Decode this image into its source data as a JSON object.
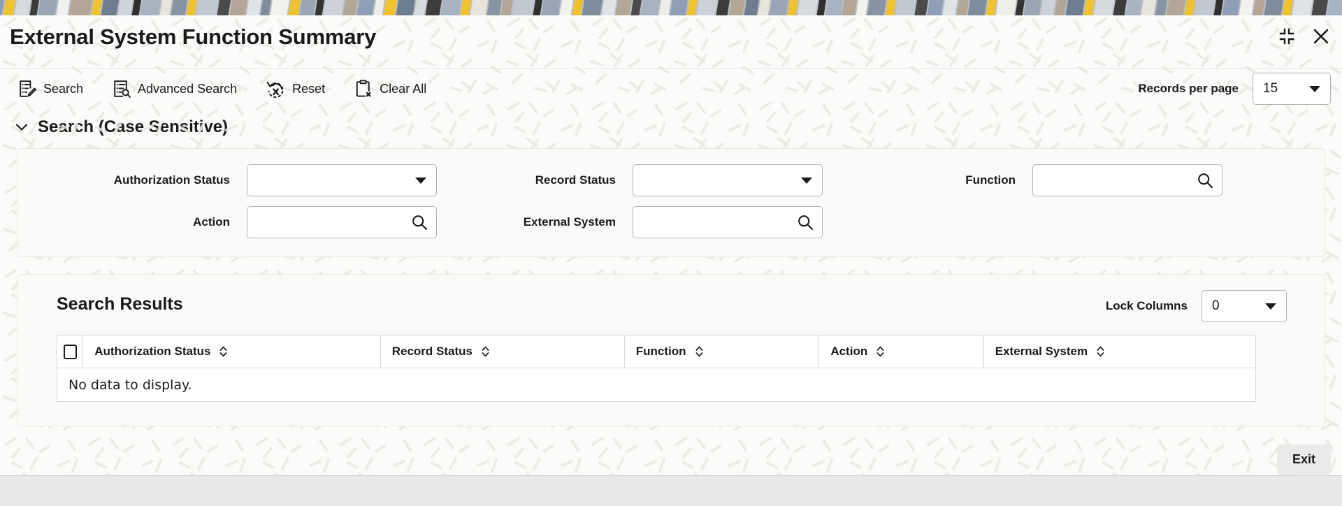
{
  "window": {
    "title": "External System Function Summary",
    "controls": [
      {
        "name": "minimize-restore-icon",
        "label": "Minimize"
      },
      {
        "name": "close-icon",
        "label": "Close"
      }
    ]
  },
  "toolbar": {
    "items": [
      {
        "icon": "search-form-icon",
        "label": "Search"
      },
      {
        "icon": "advanced-search-icon",
        "label": "Advanced Search"
      },
      {
        "icon": "reset-icon",
        "label": "Reset"
      },
      {
        "icon": "clear-all-icon",
        "label": "Clear All"
      }
    ],
    "records_per_page_label": "Records per page",
    "records_per_page_value": "15"
  },
  "search_section": {
    "title": "Search (Case Sensitive)",
    "expanded": true,
    "fields": [
      {
        "label": "Authorization Status",
        "type": "select",
        "value": "",
        "placeholder": ""
      },
      {
        "label": "Record Status",
        "type": "select",
        "value": "",
        "placeholder": ""
      },
      {
        "label": "Function",
        "type": "lov",
        "value": "",
        "placeholder": ""
      },
      {
        "label": "Action",
        "type": "lov",
        "value": "",
        "placeholder": ""
      },
      {
        "label": "External System",
        "type": "lov",
        "value": "",
        "placeholder": ""
      }
    ]
  },
  "results": {
    "title": "Search Results",
    "lock_columns_label": "Lock Columns",
    "lock_columns_value": "0",
    "columns": [
      {
        "label": "Authorization Status",
        "sortable": true
      },
      {
        "label": "Record Status",
        "sortable": true
      },
      {
        "label": "Function",
        "sortable": true
      },
      {
        "label": "Action",
        "sortable": true
      },
      {
        "label": "External System",
        "sortable": true
      }
    ],
    "empty_message": "No data to display.",
    "rows": []
  },
  "footer": {
    "exit_label": "Exit"
  },
  "colors": {
    "page_bg": "#fbfbfa",
    "panel_bg": "#fafaf8",
    "border": "#d8d8d4",
    "text": "#1a1a1a",
    "button_bg": "#eceae8",
    "footer_bg": "#e9e9e9",
    "band_yellow": "#f0c230",
    "band_blue": "#8f9fb5",
    "band_dark": "#3c3c3c",
    "band_tan": "#b4a696"
  }
}
